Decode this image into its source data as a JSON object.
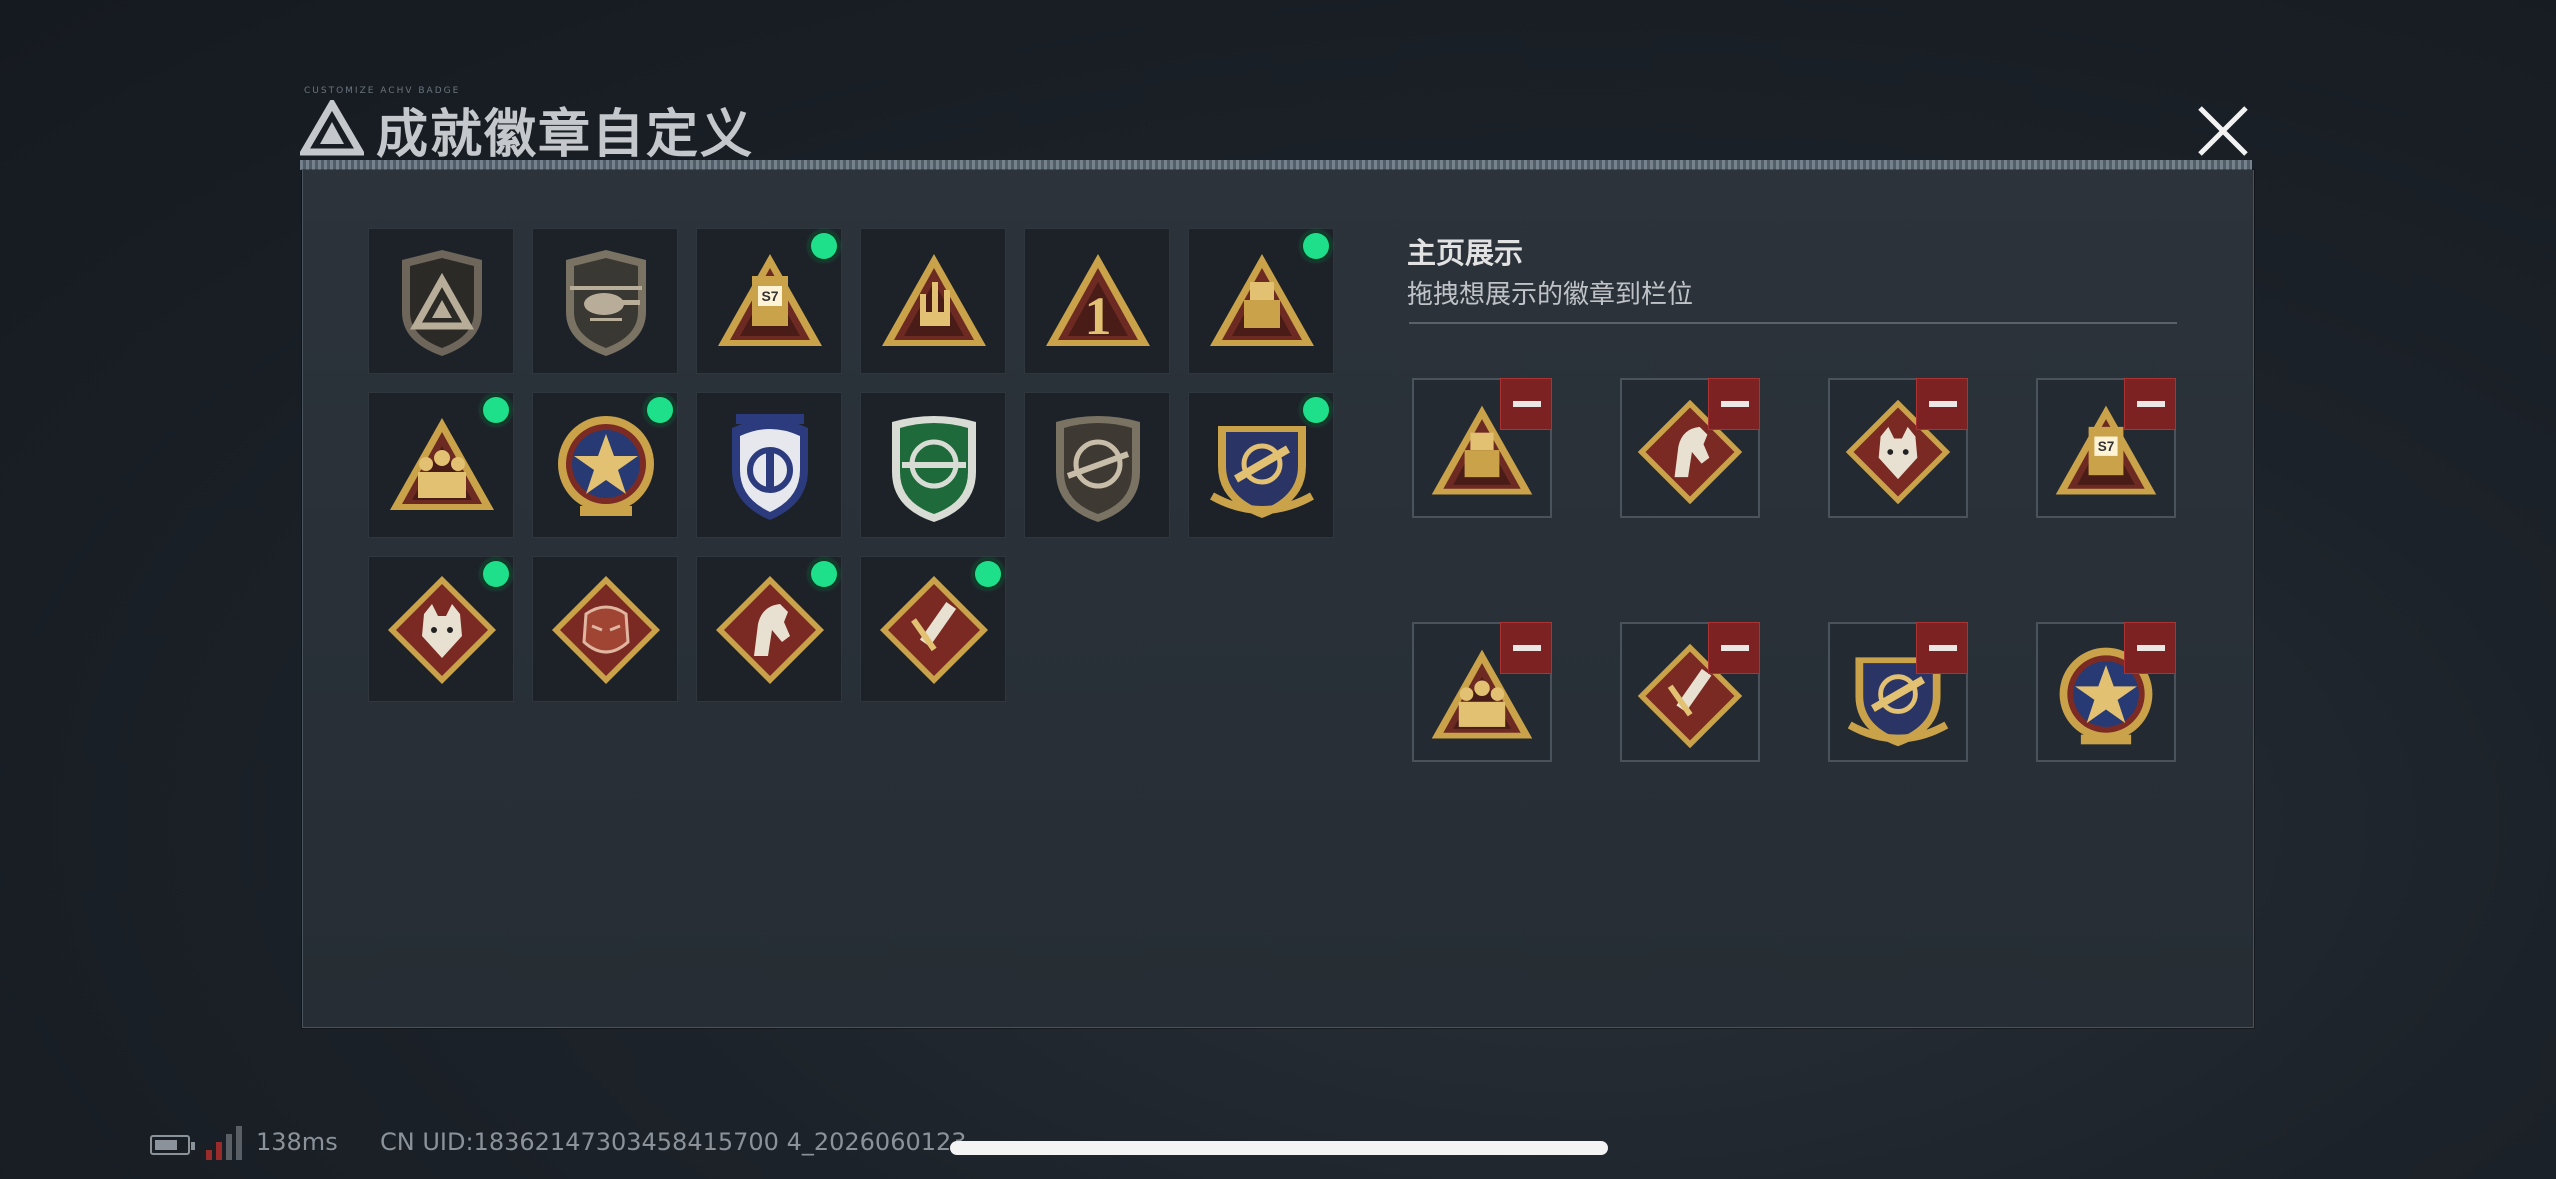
{
  "header": {
    "title": "成就徽章自定义",
    "micro_text": "CUSTOMIZE ACHV BADGE"
  },
  "display": {
    "title": "主页展示",
    "subtitle": "拖拽想展示的徽章到栏位"
  },
  "badges": [
    {
      "icon": "delta-shield-badge-icon",
      "equipped": false
    },
    {
      "icon": "helicopter-shield-badge-icon",
      "equipped": false
    },
    {
      "icon": "s7-triangle-badge-icon",
      "equipped": true
    },
    {
      "icon": "hand-sign-triangle-badge-icon",
      "equipped": false
    },
    {
      "icon": "number-one-triangle-badge-icon",
      "equipped": false
    },
    {
      "icon": "usb-triangle-badge-icon",
      "equipped": true
    },
    {
      "icon": "squad-triangle-badge-icon",
      "equipped": true
    },
    {
      "icon": "star-wreath-badge-icon",
      "equipped": true
    },
    {
      "icon": "blue-police-badge-icon",
      "equipped": false
    },
    {
      "icon": "green-rifle-shield-badge-icon",
      "equipped": false
    },
    {
      "icon": "grey-rifle-shield-badge-icon",
      "equipped": false
    },
    {
      "icon": "rocket-crest-badge-icon",
      "equipped": true
    },
    {
      "icon": "wolf-diamond-badge-icon",
      "equipped": true
    },
    {
      "icon": "dragon-diamond-badge-icon",
      "equipped": false
    },
    {
      "icon": "horse-diamond-badge-icon",
      "equipped": true
    },
    {
      "icon": "syringe-diamond-badge-icon",
      "equipped": true
    }
  ],
  "slots": [
    {
      "icon": "usb-triangle-badge-icon"
    },
    {
      "icon": "horse-diamond-badge-icon"
    },
    {
      "icon": "wolf-diamond-badge-icon"
    },
    {
      "icon": "s7-triangle-badge-icon"
    },
    {
      "icon": "squad-triangle-badge-icon"
    },
    {
      "icon": "syringe-diamond-badge-icon"
    },
    {
      "icon": "rocket-crest-badge-icon"
    },
    {
      "icon": "star-wreath-badge-icon"
    }
  ],
  "footer": {
    "ping": "138ms",
    "uid": "CN UID:18362147303458415700 4_2026060123"
  },
  "colors": {
    "equipped_dot": "#1fe08a",
    "remove_button": "#7c2223",
    "gold": "#c9a24a",
    "maroon": "#6d2a22"
  }
}
